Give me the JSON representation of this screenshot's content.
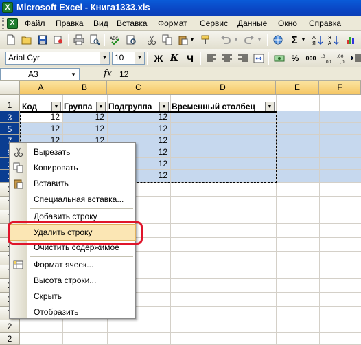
{
  "window": {
    "title": "Microsoft Excel - Книга1333.xls"
  },
  "menu": [
    "Файл",
    "Правка",
    "Вид",
    "Вставка",
    "Формат",
    "Сервис",
    "Данные",
    "Окно",
    "Справка"
  ],
  "toolbar": {
    "font_name": "Arial Cyr",
    "font_size": "10",
    "bold": "Ж",
    "italic": "К",
    "underline": "Ч"
  },
  "formula_bar": {
    "name_box": "A3",
    "fx": "fx",
    "value": "12"
  },
  "sheet": {
    "columns": [
      "A",
      "B",
      "C",
      "D",
      "E",
      "F"
    ],
    "rows": [
      "1",
      "3",
      "5",
      "7",
      "9",
      "1",
      "1",
      "1",
      "1",
      "1",
      "1",
      "1",
      "1",
      "1",
      "1",
      "1",
      "1",
      "2",
      "2",
      "2"
    ],
    "headers": [
      "Код",
      "Группа",
      "Подгруппа",
      "Временный столбец"
    ],
    "values": [
      [
        "12",
        "12",
        "12"
      ],
      [
        "12",
        "12",
        "12"
      ],
      [
        "12",
        "12",
        "12"
      ],
      [
        "12",
        "12",
        "12"
      ],
      [
        "12",
        "12",
        "12"
      ],
      [
        "12",
        "12",
        "12"
      ]
    ]
  },
  "context_menu": {
    "items": [
      {
        "label": "Вырезать",
        "icon": "scissors-icon"
      },
      {
        "label": "Копировать",
        "icon": "copy-icon"
      },
      {
        "label": "Вставить",
        "icon": "paste-icon"
      },
      {
        "label": "Специальная вставка..."
      },
      {
        "label": "Добавить строку"
      },
      {
        "label": "Удалить строку"
      },
      {
        "label": "Очистить содержимое"
      },
      {
        "label": "Формат ячеек...",
        "icon": "format-cells-icon"
      },
      {
        "label": "Высота строки..."
      },
      {
        "label": "Скрыть"
      },
      {
        "label": "Отобразить"
      }
    ]
  },
  "colors": {
    "highlight_box": "#e0152b",
    "selection": "#c6d8ee",
    "title_bar": "#0a46c4"
  }
}
